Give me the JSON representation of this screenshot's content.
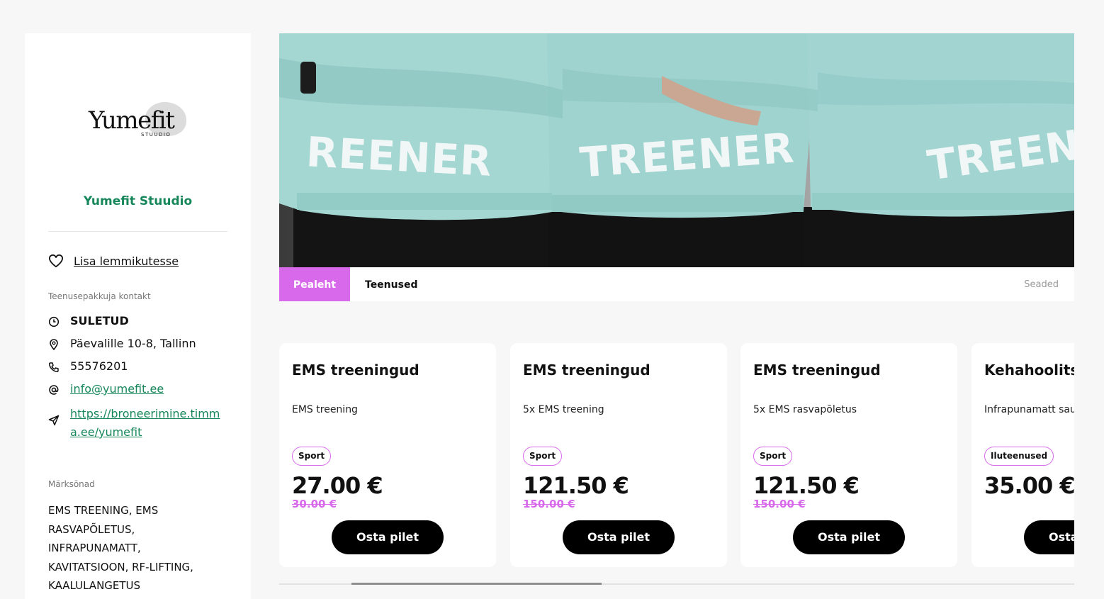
{
  "brand": {
    "logo_text": "Yumefit",
    "logo_sub": "STUUDIO",
    "name": "Yumefit Stuudio"
  },
  "sidebar": {
    "favorite_label": "Lisa lemmikutesse",
    "contact_heading": "Teenusepakkuja kontakt",
    "status": "SULETUD",
    "address": "Päevalille 10-8, Tallinn",
    "phone": "55576201",
    "email": "info@yumefit.ee",
    "website": "https://broneerimine.timma.ee/yumefit",
    "keywords_heading": "Märksõnad",
    "keywords": "EMS TREENING, EMS RASVAPÕLETUS, INFRAPUNAMATT, KAVITATSIOON, RF-LIFTING, KAALULANGETUS"
  },
  "hero": {
    "shirt_text_1": "REENER",
    "shirt_text_2": "TREENER",
    "shirt_text_3": "TREENER"
  },
  "tabs": {
    "home": "Pealeht",
    "services": "Teenused",
    "settings": "Seaded"
  },
  "cards": [
    {
      "title": "EMS treeningud",
      "desc": "EMS treening",
      "badge": "Sport",
      "price": "27.00 €",
      "old_price": "30.00 €",
      "button": "Osta pilet"
    },
    {
      "title": "EMS treeningud",
      "desc": "5x EMS treening",
      "badge": "Sport",
      "price": "121.50 €",
      "old_price": "150.00 €",
      "button": "Osta pilet"
    },
    {
      "title": "EMS treeningud",
      "desc": "5x EMS rasvapõletus",
      "badge": "Sport",
      "price": "121.50 €",
      "old_price": "150.00 €",
      "button": "Osta pilet"
    },
    {
      "title": "Kehahoolitsus",
      "desc": "Infrapunamatt sauna",
      "badge": "Iluteenused",
      "price": "35.00 €",
      "old_price": "",
      "button": "Osta pilet"
    }
  ],
  "colors": {
    "accent": "#d769ea",
    "brand_green": "#16875a",
    "shirt": "#9fd3cf"
  },
  "icons": [
    "heart-icon",
    "clock-icon",
    "location-pin-icon",
    "phone-icon",
    "at-icon",
    "send-icon"
  ]
}
